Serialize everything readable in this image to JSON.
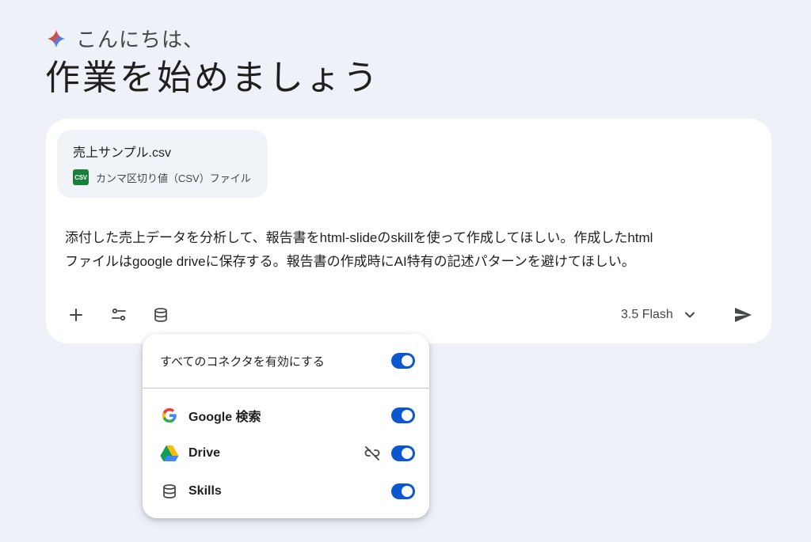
{
  "greeting": {
    "hello": "こんにちは、",
    "headline": "作業を始めましょう"
  },
  "attachment": {
    "file_name": "売上サンプル.csv",
    "badge": "CSV",
    "file_type": "カンマ区切り値（CSV）ファイル"
  },
  "prompt": {
    "line1": "添付した売上データを分析して、報告書をhtml-slideのskillを使って作成してほしい。作成したhtml",
    "line2": "ファイルはgoogle driveに保存する。報告書の作成時にAI特有の記述パターンを避けてほしい。"
  },
  "toolbar": {
    "add_icon": "plus-icon",
    "tools_icon": "tune-icon",
    "connectors_icon": "database-icon",
    "model_label": "3.5 Flash",
    "model_dropdown_icon": "chevron-down-icon",
    "send_icon": "send-icon"
  },
  "connectors": {
    "enable_all_label": "すべてのコネクタを有効にする",
    "enable_all_on": true,
    "items": [
      {
        "label": "Google 検索",
        "icon": "google-g-icon",
        "enabled": true
      },
      {
        "label": "Drive",
        "icon": "google-drive-icon",
        "enabled": true,
        "extra_icon": "link-off-icon"
      },
      {
        "label": "Skills",
        "icon": "database-icon",
        "enabled": true
      }
    ]
  },
  "colors": {
    "background": "#eef2f8",
    "card": "#ffffff",
    "chip": "#f0f4f9",
    "toggle_on": "#0b57d0",
    "csv_badge": "#188038"
  }
}
